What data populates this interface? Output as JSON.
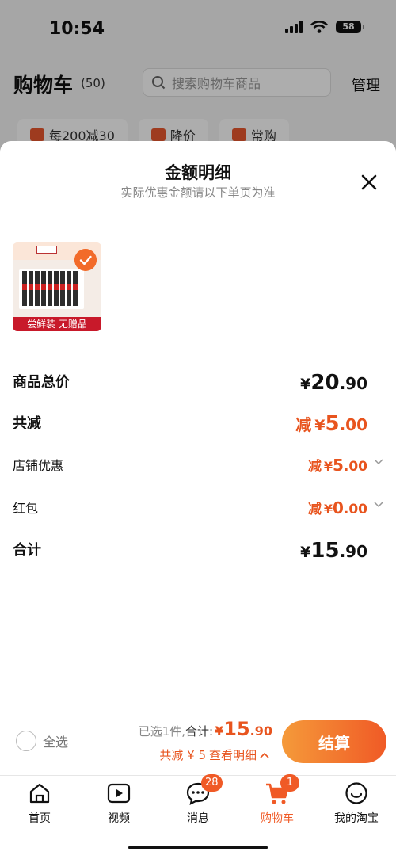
{
  "status_bar": {
    "time": "10:54",
    "battery": "58"
  },
  "cart_header": {
    "title": "购物车",
    "count": "(50)",
    "search_placeholder": "搜索购物车商品",
    "manage": "管理",
    "chips": [
      "每200减30",
      "降价",
      "常购"
    ]
  },
  "sheet": {
    "title": "金额明细",
    "subtitle": "实际优惠金额请以下单页为准",
    "product": {
      "tag": "尝鲜装 无赠品",
      "selected": true
    },
    "rows": [
      {
        "label": "商品总价",
        "currency": "¥",
        "int": "20",
        "dec": ".90"
      },
      {
        "label": "共减",
        "prefix": "减",
        "currency": "¥",
        "int": "5",
        "dec": ".00"
      },
      {
        "label": "店铺优惠",
        "prefix": "减",
        "currency": "¥",
        "int": "5",
        "dec": ".00"
      },
      {
        "label": "红包",
        "prefix": "减",
        "currency": "¥",
        "int": "0",
        "dec": ".00"
      },
      {
        "label": "合计",
        "currency": "¥",
        "int": "15",
        "dec": ".90"
      }
    ]
  },
  "bottom_bar": {
    "select_all": "全选",
    "selected_text": "已选1件,",
    "total_label": "合计:",
    "currency": "¥",
    "total_int": "15",
    "total_dec": ".90",
    "discount_text": "共减 ¥ 5",
    "detail_link": "查看明细",
    "checkout": "结算"
  },
  "tabbar": {
    "tabs": [
      {
        "label": "首页",
        "icon": "home-icon"
      },
      {
        "label": "视频",
        "icon": "video-icon"
      },
      {
        "label": "消息",
        "icon": "message-icon",
        "badge": "28"
      },
      {
        "label": "购物车",
        "icon": "cart-icon",
        "badge": "1",
        "active": true
      },
      {
        "label": "我的淘宝",
        "icon": "profile-icon"
      }
    ]
  },
  "colors": {
    "accent": "#f05a26",
    "product_tag": "#c8192a"
  }
}
